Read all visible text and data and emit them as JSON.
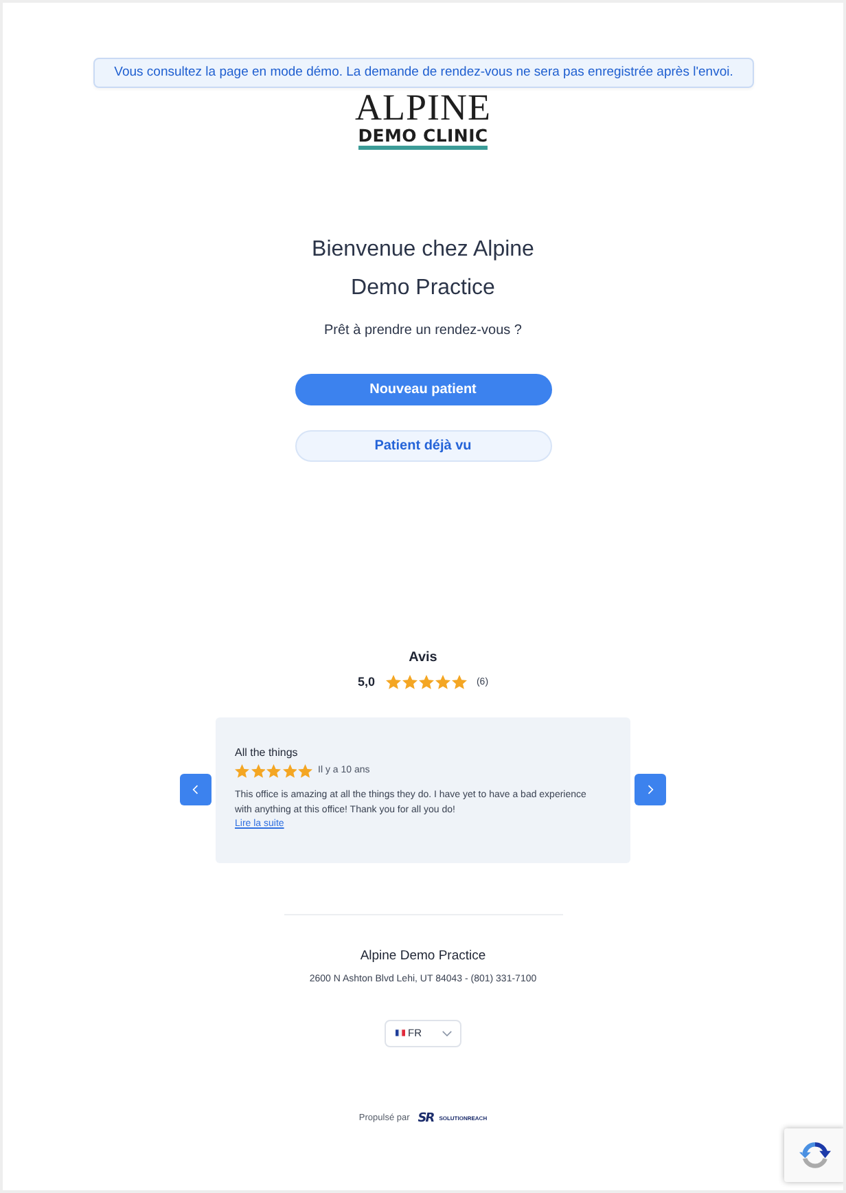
{
  "demo_banner": "Vous consultez la page en mode démo. La demande de rendez-vous ne sera pas enregistrée après l'envoi.",
  "logo": {
    "line_1": "ALPINE",
    "line_2": "DEMO CLINIC"
  },
  "welcome": {
    "title": "Bienvenue chez Alpine Demo Practice",
    "subtitle": "Prêt à prendre un rendez-vous ?"
  },
  "buttons": [
    {
      "label": "Nouveau patient",
      "kind": "primary"
    },
    {
      "label": "Patient déjà vu",
      "kind": "secondary"
    }
  ],
  "reviews": {
    "title": "Avis",
    "average": "5,0",
    "stars": 5,
    "count": "(6)",
    "current": {
      "title": "All the things",
      "stars": 5,
      "age": "Il y a 10 ans",
      "text": "This office is amazing at all the things they do. I have yet to have a bad experience with anything at this office! Thank you for all you do!",
      "read_more": "Lire la suite"
    }
  },
  "footer": {
    "practice_name": "Alpine Demo Practice",
    "address": "2600 N Ashton Blvd Lehi, UT 84043 - (801) 331-7100",
    "language": "FR",
    "powered_by": "Propulsé par",
    "brand_mark": "SR",
    "brand_name": "SOLUTIONREACH"
  }
}
